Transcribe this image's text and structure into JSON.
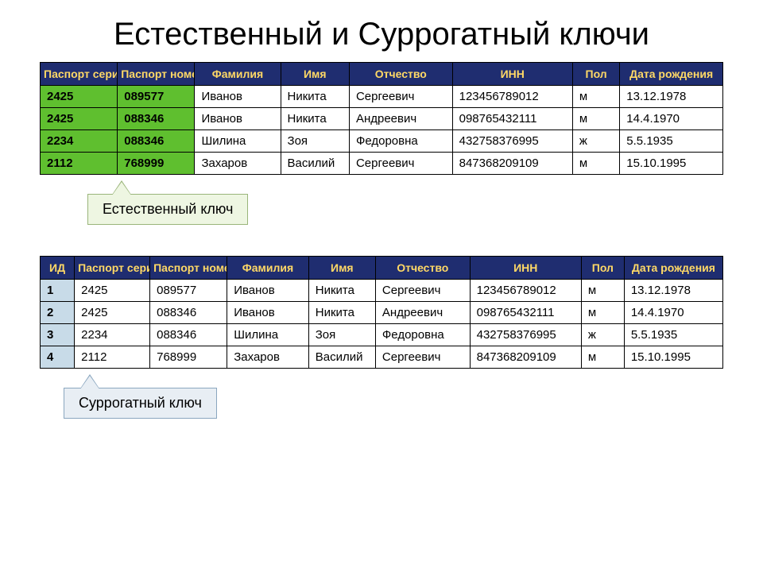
{
  "title": "Естественный и Суррогатный ключи",
  "table1": {
    "headers": [
      "Паспорт серия",
      "Паспорт номер",
      "Фамилия",
      "Имя",
      "Отчество",
      "ИНН",
      "Пол",
      "Дата рождения"
    ],
    "rows": [
      [
        "2425",
        "089577",
        "Иванов",
        "Никита",
        "Сергеевич",
        "123456789012",
        "м",
        "13.12.1978"
      ],
      [
        "2425",
        "088346",
        "Иванов",
        "Никита",
        "Андреевич",
        "098765432111",
        "м",
        "14.4.1970"
      ],
      [
        "2234",
        "088346",
        "Шилина",
        "Зоя",
        "Федоровна",
        "432758376995",
        "ж",
        "5.5.1935"
      ],
      [
        "2112",
        "768999",
        "Захаров",
        "Василий",
        "Сергеевич",
        "847368209109",
        "м",
        "15.10.1995"
      ]
    ],
    "callout": "Естественный ключ"
  },
  "table2": {
    "headers": [
      "ИД",
      "Паспорт серия",
      "Паспорт номер",
      "Фамилия",
      "Имя",
      "Отчество",
      "ИНН",
      "Пол",
      "Дата рождения"
    ],
    "rows": [
      [
        "1",
        "2425",
        "089577",
        "Иванов",
        "Никита",
        "Сергеевич",
        "123456789012",
        "м",
        "13.12.1978"
      ],
      [
        "2",
        "2425",
        "088346",
        "Иванов",
        "Никита",
        "Андреевич",
        "098765432111",
        "м",
        "14.4.1970"
      ],
      [
        "3",
        "2234",
        "088346",
        "Шилина",
        "Зоя",
        "Федоровна",
        "432758376995",
        "ж",
        "5.5.1935"
      ],
      [
        "4",
        "2112",
        "768999",
        "Захаров",
        "Василий",
        "Сергеевич",
        "847368209109",
        "м",
        "15.10.1995"
      ]
    ],
    "callout": "Суррогатный ключ"
  }
}
